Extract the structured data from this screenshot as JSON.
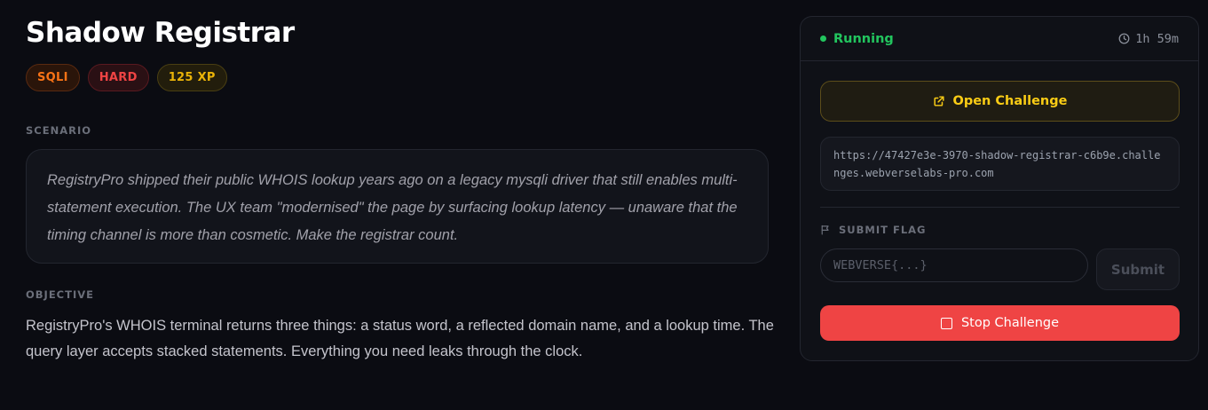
{
  "challenge": {
    "title": "Shadow Registrar",
    "badges": {
      "category": "SQLI",
      "difficulty": "HARD",
      "xp": "125 XP"
    },
    "scenario_label": "SCENARIO",
    "scenario_text": "RegistryPro shipped their public WHOIS lookup years ago on a legacy mysqli driver that still enables multi-statement execution. The UX team \"modernised\" the page by surfacing lookup latency — unaware that the timing channel is more than cosmetic. Make the registrar count.",
    "objective_label": "OBJECTIVE",
    "objective_text": "RegistryPro's WHOIS terminal returns three things: a status word, a reflected domain name, and a lookup time. The query layer accepts stacked statements. Everything you need leaks through the clock."
  },
  "panel": {
    "status": "Running",
    "timer": "1h 59m",
    "open_label": "Open Challenge",
    "url": "https://47427e3e-3970-shadow-registrar-c6b9e.challenges.webverselabs-pro.com",
    "flag_label": "SUBMIT FLAG",
    "flag_placeholder": "WEBVERSE{...}",
    "submit_label": "Submit",
    "stop_label": "Stop Challenge"
  }
}
